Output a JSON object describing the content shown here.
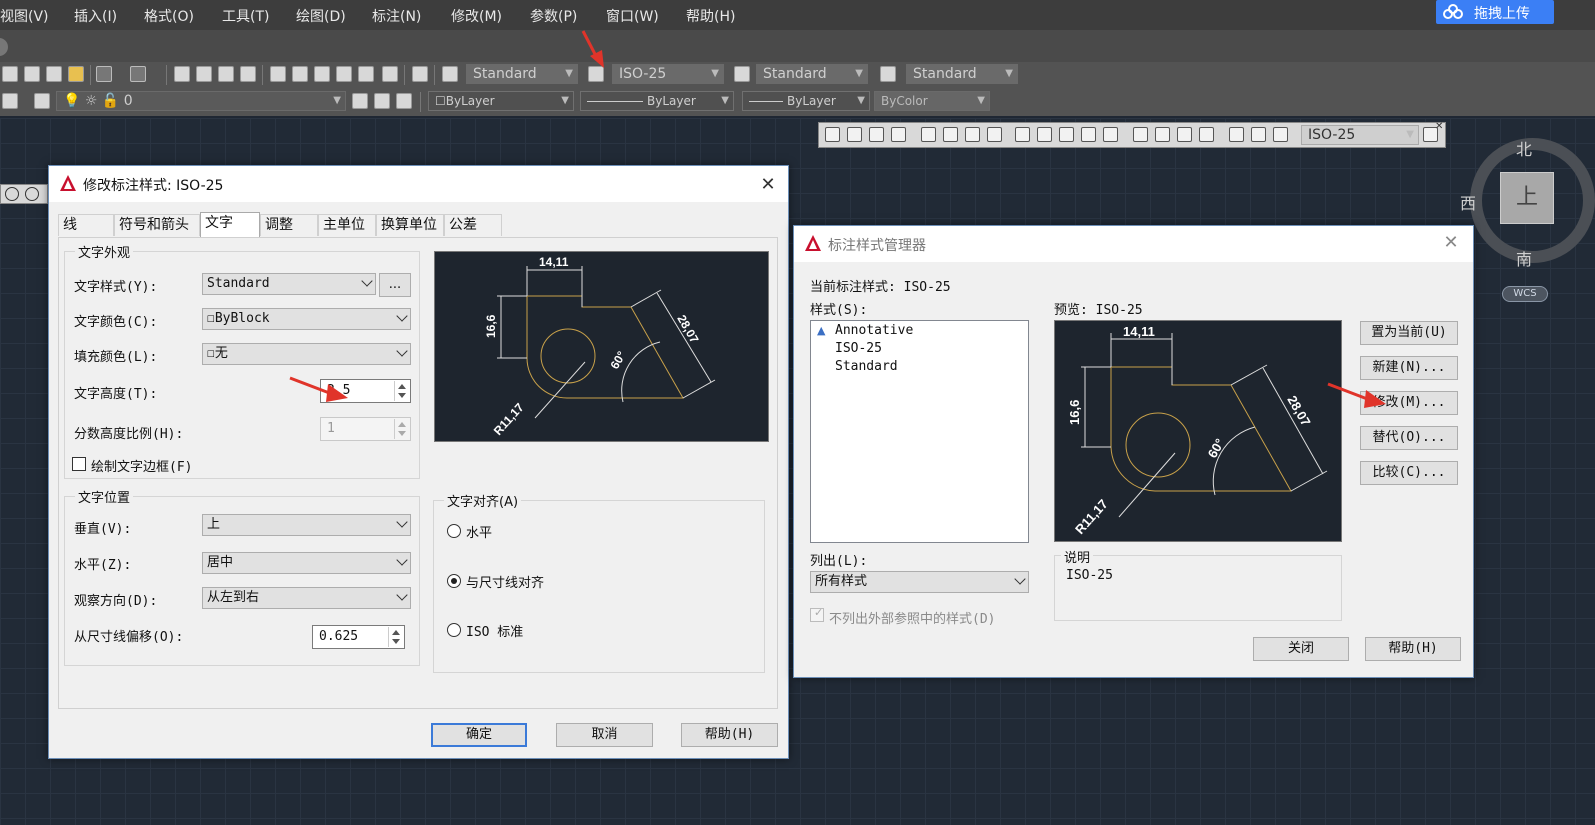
{
  "menu": [
    "视图(V)",
    "插入(I)",
    "格式(O)",
    "工具(T)",
    "绘图(D)",
    "标注(N)",
    "修改(M)",
    "参数(P)",
    "窗口(W)",
    "帮助(H)"
  ],
  "upload_label": "拖拽上传",
  "toolbar": {
    "text_style": "Standard",
    "dim_style": "ISO-25",
    "table_style": "Standard",
    "mleader_style": "Standard",
    "layer": "0",
    "color": "ByLayer",
    "linetype": "ByLayer",
    "lineweight": "ByLayer",
    "plotstyle": "ByColor",
    "dimbar_style": "ISO-25"
  },
  "viewcube": {
    "north": "北",
    "south": "南",
    "west": "西",
    "face": "上",
    "wcs": "WCS"
  },
  "modify_dialog": {
    "title": "修改标注样式: ISO-25",
    "tabs": [
      "线",
      "符号和箭头",
      "文字",
      "调整",
      "主单位",
      "换算单位",
      "公差"
    ],
    "appearance_group": "文字外观",
    "text_style_label": "文字样式(Y):",
    "text_style_value": "Standard",
    "browse_label": "...",
    "text_color_label": "文字颜色(C):",
    "text_color_value": "ByBlock",
    "fill_color_label": "填充颜色(L):",
    "fill_color_value": "无",
    "text_height_label": "文字高度(T):",
    "text_height_value": "2.5",
    "fraction_label": "分数高度比例(H):",
    "fraction_value": "1",
    "frame_label": "绘制文字边框(F)",
    "position_group": "文字位置",
    "vertical_label": "垂直(V):",
    "vertical_value": "上",
    "horizontal_label": "水平(Z):",
    "horizontal_value": "居中",
    "view_dir_label": "观察方向(D):",
    "view_dir_value": "从左到右",
    "offset_label": "从尺寸线偏移(O):",
    "offset_value": "0.625",
    "align_group": "文字对齐(A)",
    "align_options": [
      "水平",
      "与尺寸线对齐",
      "ISO 标准"
    ],
    "ok": "确定",
    "cancel": "取消",
    "help": "帮助(H)"
  },
  "manager_dialog": {
    "title": "标注样式管理器",
    "current_label": "当前标注样式: ISO-25",
    "styles_label": "样式(S):",
    "styles": [
      "Annotative",
      "ISO-25",
      "Standard"
    ],
    "preview_label": "预览: ISO-25",
    "buttons": [
      "置为当前(U)",
      "新建(N)...",
      "修改(M)...",
      "替代(O)...",
      "比较(C)..."
    ],
    "list_label": "列出(L):",
    "list_value": "所有样式",
    "xref_label": "不列出外部参照中的样式(D)",
    "desc_label": "说明",
    "desc_value": "ISO-25",
    "close": "关闭",
    "help": "帮助(H)"
  },
  "preview_dims": {
    "top": "14,11",
    "left": "16,6",
    "diag": "28,07",
    "angle": "60°",
    "radius": "R11,17"
  }
}
